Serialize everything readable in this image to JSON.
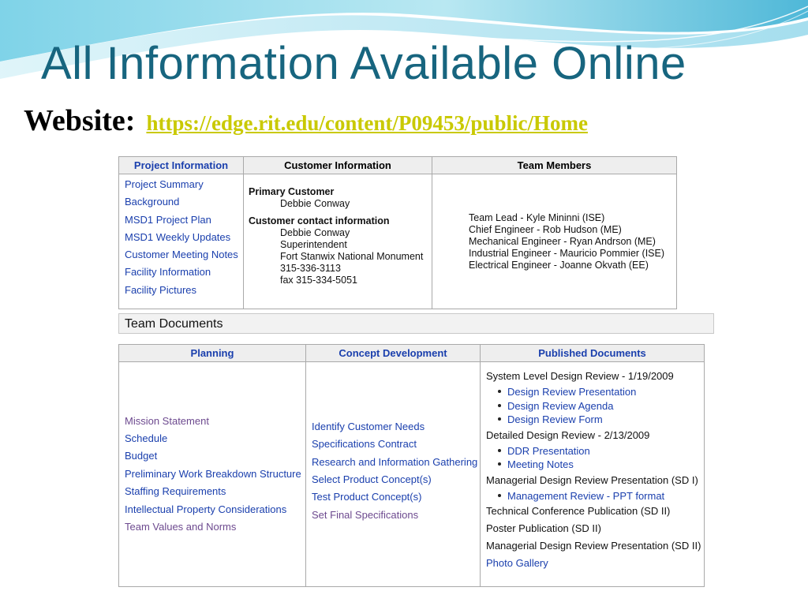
{
  "slide": {
    "title": "All Information Available Online",
    "website_label": "Website:",
    "website_url": "https://edge.rit.edu/content/P09453/public/Home"
  },
  "colors": {
    "title": "#17657f",
    "link_yellow": "#c9c900",
    "link_blue": "#1a3fad",
    "visited_purple": "#6d4a8f",
    "header_bg": "#eeeeee"
  },
  "info_table": {
    "headers": [
      "Project Information",
      "Customer Information",
      "Team Members"
    ],
    "project_links": [
      "Project Summary",
      "Background",
      "MSD1 Project Plan",
      "MSD1 Weekly Updates",
      "Customer Meeting Notes",
      "Facility Information",
      "Facility Pictures"
    ],
    "customer": {
      "primary_heading": "Primary Customer",
      "primary_name": "Debbie Conway",
      "contact_heading": "Customer contact information",
      "contact_lines": [
        "Debbie Conway",
        "Superintendent",
        "Fort Stanwix National Monument",
        "315-336-3113",
        "fax 315-334-5051"
      ]
    },
    "team_members": [
      "Team Lead - Kyle Mininni (ISE)",
      "Chief Engineer - Rob Hudson (ME)",
      "Mechanical Engineer - Ryan Andrson (ME)",
      "Industrial Engineer - Mauricio Pommier (ISE)",
      "Electrical Engineer - Joanne Okvath (EE)"
    ]
  },
  "team_documents": {
    "section_title": "Team Documents",
    "headers": [
      "Planning",
      "Concept Development",
      "Published Documents"
    ],
    "planning": [
      "Mission Statement",
      "Schedule",
      "Budget",
      "Preliminary Work Breakdown Structure",
      "Staffing Requirements",
      "Intellectual Property Considerations",
      "Team Values and Norms"
    ],
    "concept": [
      "Identify Customer Needs",
      "Specifications Contract",
      "Research and Information Gathering",
      "Select Product Concept(s)",
      "Test Product Concept(s)",
      "Set Final Specifications"
    ],
    "published": {
      "sldr_title": "System Level Design Review - 1/19/2009",
      "sldr_items": [
        "Design Review Presentation",
        "Design Review Agenda",
        "Design Review Form"
      ],
      "ddr_title": "Detailed Design Review - 2/13/2009",
      "ddr_items": [
        "DDR Presentation",
        "Meeting Notes"
      ],
      "mdr1_title": "Managerial Design Review Presentation (SD I)",
      "mdr1_items": [
        "Management Review - PPT format"
      ],
      "tech_pub": "Technical Conference Publication (SD II)",
      "poster_pub": "Poster Publication (SD II)",
      "mdr2_title": "Managerial Design Review Presentation (SD II)",
      "photo_gallery": "Photo Gallery"
    }
  }
}
